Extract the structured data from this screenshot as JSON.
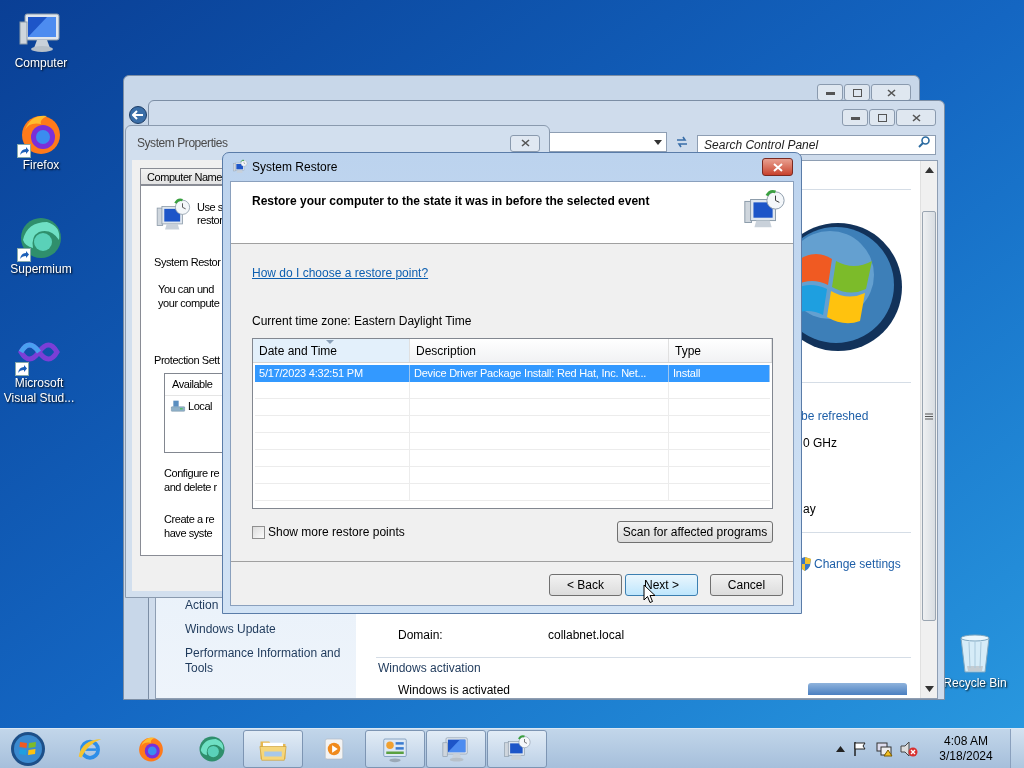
{
  "desktop_icons": [
    {
      "kind": "computer",
      "label": "Computer",
      "shortcut": false
    },
    {
      "kind": "firefox",
      "label": "Firefox",
      "shortcut": true
    },
    {
      "kind": "supermium",
      "label": "Supermium",
      "shortcut": true
    },
    {
      "kind": "visual-studio",
      "label": "Microsoft Visual Stud...",
      "shortcut": true
    },
    {
      "kind": "recycle-bin",
      "label": "Recycle Bin",
      "shortcut": false
    }
  ],
  "control_panel": {
    "search": {
      "placeholder": "Search Control Panel"
    },
    "left_pane": [
      "Action",
      "Windows Update",
      "Performance Information and Tools"
    ],
    "update_link": "be refreshed",
    "processor": "0 GHz",
    "pen_touch": "ay",
    "change_settings": "Change settings",
    "domain_label": "Domain:",
    "domain_value": "collabnet.local",
    "activation_heading": "Windows activation",
    "activation_status": "Windows is activated"
  },
  "system_properties": {
    "title": "System Properties",
    "tabs": [
      {
        "label": "Computer Name",
        "selected": false
      }
    ],
    "intro_lines": [
      "Use s",
      "restor"
    ],
    "section_heading": "System Restor",
    "description_lines": [
      "You can und",
      "your compute"
    ],
    "protection_heading": "Protection Sett",
    "drives_column": "Available",
    "drives": [
      {
        "name": "Local"
      }
    ],
    "configure_lines": [
      "Configure re",
      "and delete r"
    ],
    "create_lines": [
      "Create a re",
      "have syste"
    ]
  },
  "system_restore": {
    "title": "System Restore",
    "heading": "Restore your computer to the state it was in before the selected event",
    "help_link": "How do I choose a restore point?",
    "time_zone": "Current time zone: Eastern Daylight Time",
    "columns": [
      {
        "label": "Date and Time",
        "sorted": true
      },
      {
        "label": "Description",
        "sorted": false
      },
      {
        "label": "Type",
        "sorted": false
      }
    ],
    "rows": [
      {
        "cells": [
          "5/17/2023 4:32:51 PM",
          "Device Driver Package Install: Red Hat, Inc. Net...",
          "Install"
        ],
        "selected": true
      }
    ],
    "show_more": {
      "label": "Show more restore points",
      "checked": false
    },
    "scan_button": "Scan for affected programs",
    "buttons": [
      {
        "label": "< Back",
        "hover": false
      },
      {
        "label": "Next >",
        "hover": true
      },
      {
        "label": "Cancel",
        "hover": false
      }
    ]
  },
  "taskbar": {
    "items": [
      {
        "kind": "ie",
        "open": false
      },
      {
        "kind": "firefox",
        "open": false
      },
      {
        "kind": "supermium",
        "open": false
      },
      {
        "kind": "explorer",
        "open": true
      },
      {
        "kind": "media-player",
        "open": false
      },
      {
        "kind": "control-panel",
        "open": true
      },
      {
        "kind": "computer",
        "open": true
      },
      {
        "kind": "system-restore",
        "open": true
      }
    ],
    "clock": {
      "time": "4:08 AM",
      "date": "3/18/2024"
    }
  }
}
